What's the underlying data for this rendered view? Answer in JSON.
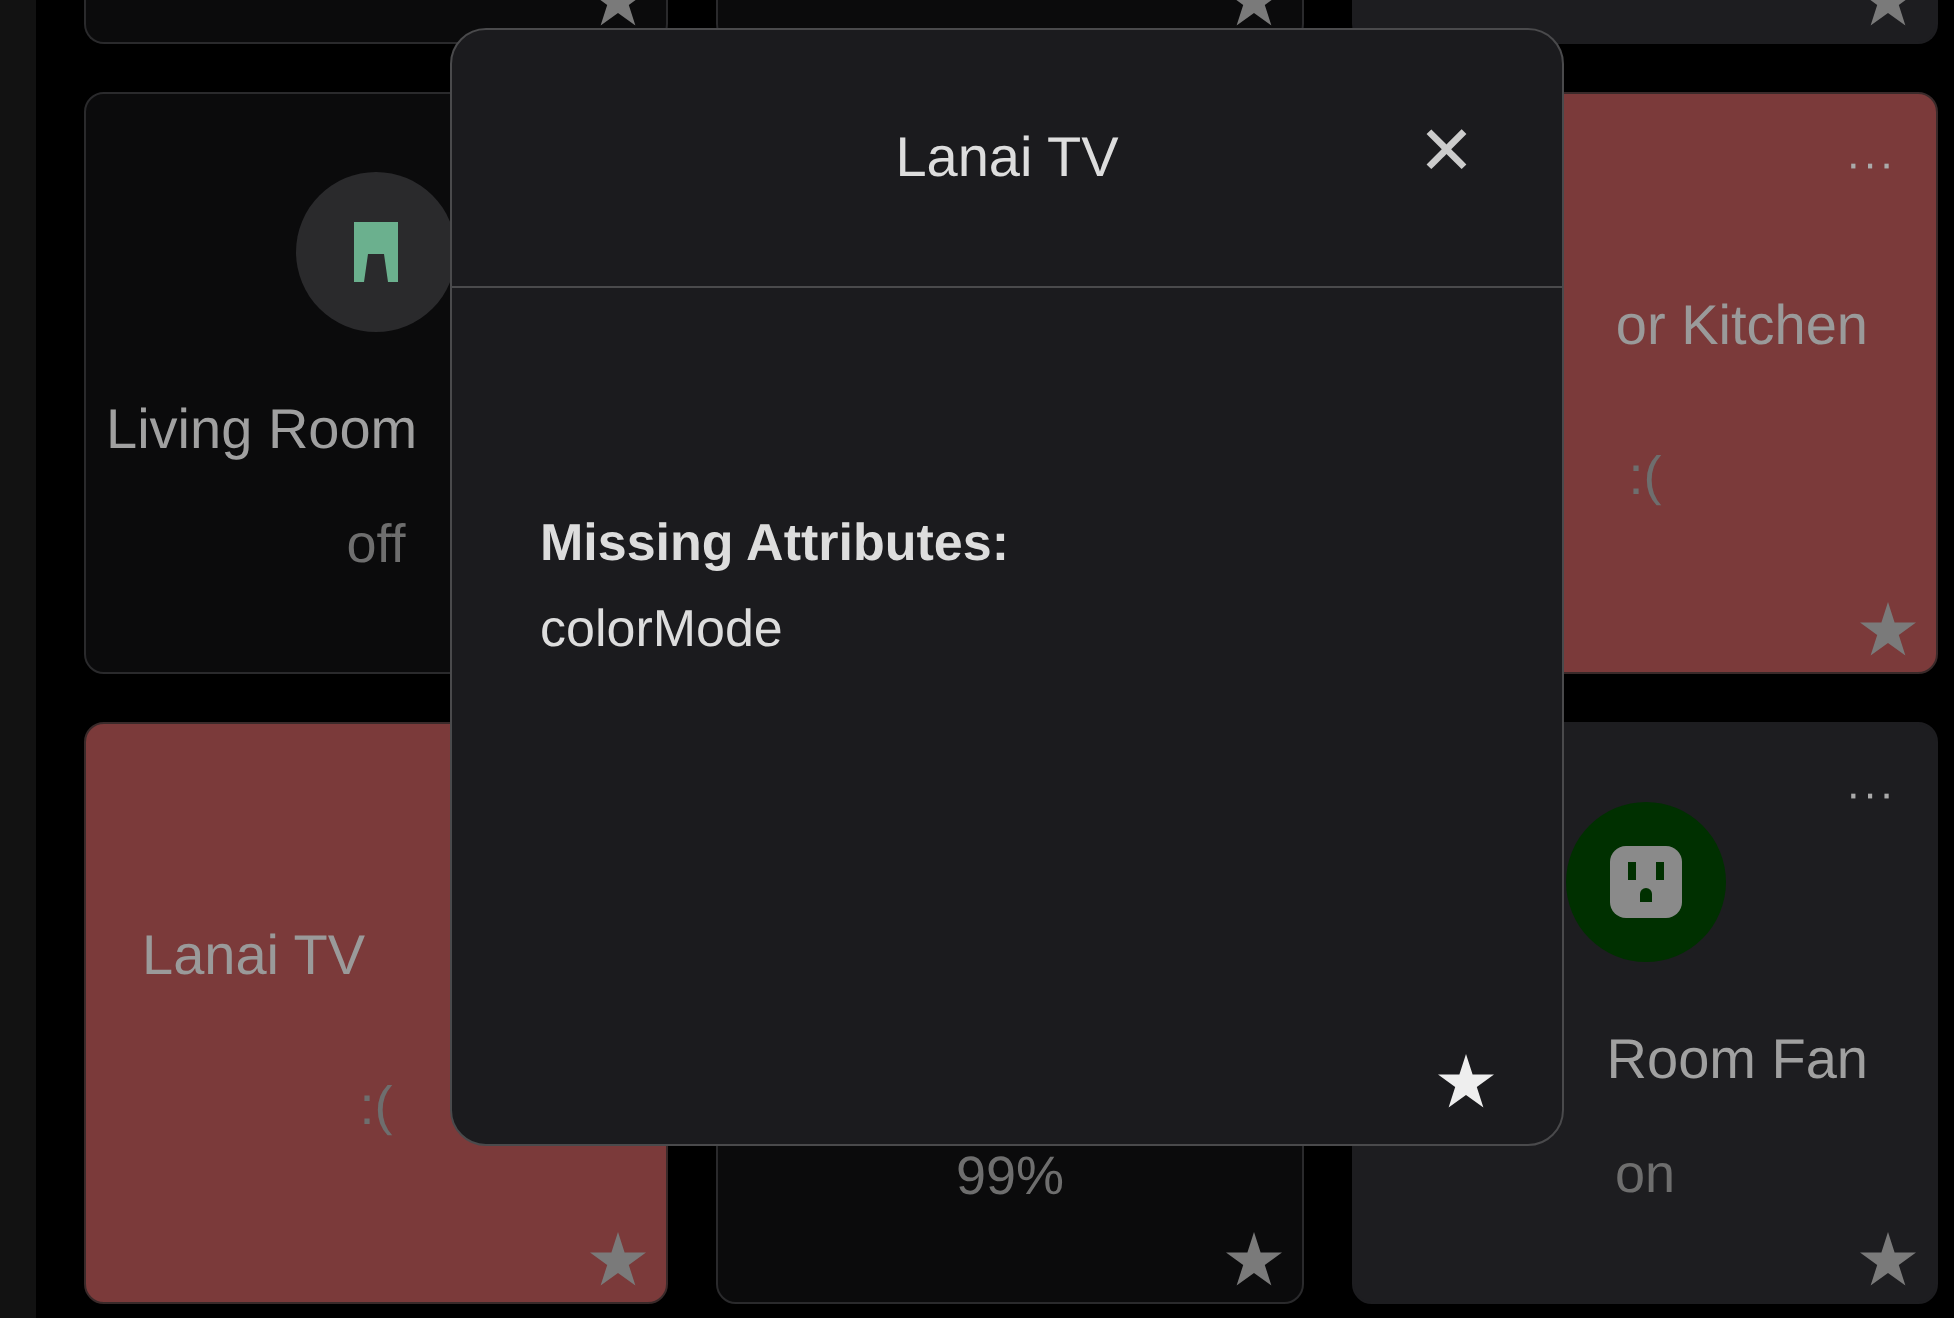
{
  "tiles": [
    {
      "kind": "off"
    },
    {
      "kind": "off"
    },
    {
      "kind": "on"
    },
    {
      "kind": "off",
      "name": "Living Room",
      "state": "off"
    },
    {
      "kind": "error",
      "menu": "···",
      "name": "or Kitchen",
      "state": ":("
    },
    {
      "kind": "error",
      "name": "Lanai TV",
      "state": ":("
    },
    {
      "kind": "off",
      "state": "99%"
    },
    {
      "kind": "on",
      "menu": "···",
      "name": "Room Fan",
      "state": "on"
    }
  ],
  "dialog": {
    "title": "Lanai TV",
    "close": "✕",
    "label": "Missing Attributes:",
    "value": "colorMode"
  }
}
